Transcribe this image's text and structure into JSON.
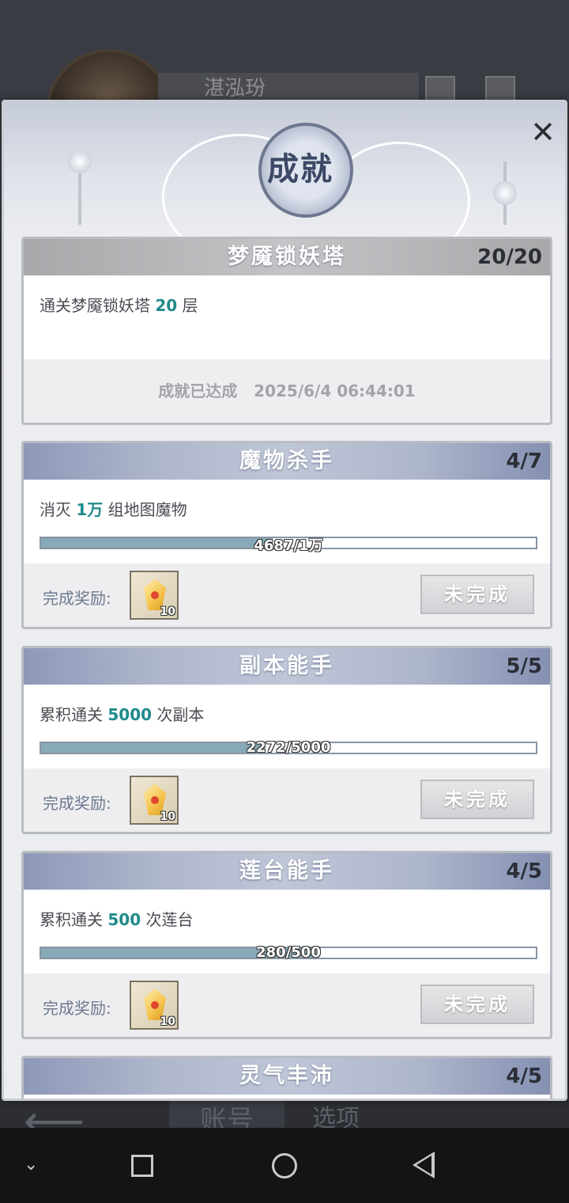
{
  "background": {
    "player_name": "湛泓玢",
    "tab_account": "账号",
    "tab_options": "选项"
  },
  "panel": {
    "title": "成就",
    "close_icon": "close-icon"
  },
  "achievements": [
    {
      "name": "梦魇锁妖塔",
      "count": "20/20",
      "desc_prefix": "通关梦魇锁妖塔 ",
      "desc_highlight": "20",
      "desc_suffix": " 层",
      "completed": true,
      "completed_label": "成就已达成",
      "completed_time": "2025/6/4 06:44:01"
    },
    {
      "name": "魔物杀手",
      "count": "4/7",
      "desc_prefix": "消灭 ",
      "desc_highlight": "1万",
      "desc_suffix": " 组地图魔物",
      "progress_text": "4687/1万",
      "progress": 0.4687,
      "reward_label": "完成奖励:",
      "reward_qty": "10",
      "status": "未完成"
    },
    {
      "name": "副本能手",
      "count": "5/5",
      "desc_prefix": "累积通关 ",
      "desc_highlight": "5000",
      "desc_suffix": " 次副本",
      "progress_text": "2272/5000",
      "progress": 0.4544,
      "reward_label": "完成奖励:",
      "reward_qty": "10",
      "status": "未完成"
    },
    {
      "name": "莲台能手",
      "count": "4/5",
      "desc_prefix": "累积通关 ",
      "desc_highlight": "500",
      "desc_suffix": " 次莲台",
      "progress_text": "280/500",
      "progress": 0.56,
      "reward_label": "完成奖励:",
      "reward_qty": "10",
      "status": "未完成"
    },
    {
      "name": "灵气丰沛",
      "count": "4/5"
    }
  ],
  "colors": {
    "highlight": "#1f8a8a",
    "progress_fill": "#86aab8",
    "header_blue": "#8e98b8"
  }
}
